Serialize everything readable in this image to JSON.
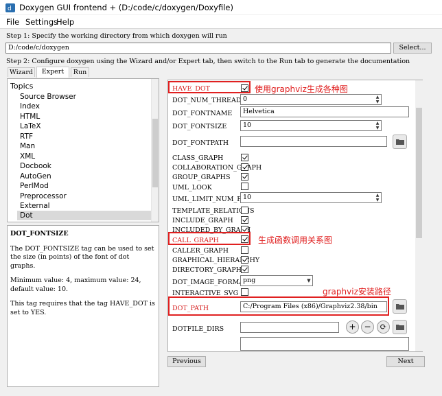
{
  "window": {
    "title": "Doxygen GUI frontend + (D:/code/c/doxygen/Doxyfile)"
  },
  "menu": {
    "file": "File",
    "settings": "Settings",
    "help": "Help"
  },
  "step1": {
    "label": "Step 1: Specify the working directory from which doxygen will run",
    "dir_value": "D:/code/c/doxygen",
    "select_button": "Select..."
  },
  "step2": {
    "label": "Step 2: Configure doxygen using the Wizard and/or Expert tab, then switch to the Run tab to generate the documentation"
  },
  "tabs": [
    "Wizard",
    "Expert",
    "Run"
  ],
  "topics": {
    "heading": "Topics",
    "items": [
      "Source Browser",
      "Index",
      "HTML",
      "LaTeX",
      "RTF",
      "Man",
      "XML",
      "Docbook",
      "AutoGen",
      "PerlMod",
      "Preprocessor",
      "External",
      "Dot"
    ],
    "selected": "Dot"
  },
  "help": {
    "title": "DOT_FONTSIZE",
    "para1": "The DOT_FONTSIZE tag can be used to set the size (in points) of the font of dot graphs.",
    "para2": "Minimum value: 4, maximum value: 24, default value: 10.",
    "para3": "This tag requires that the tag HAVE_DOT is set to YES."
  },
  "options": {
    "have_dot": "HAVE_DOT",
    "dot_num_threads": "DOT_NUM_THREADS",
    "dot_num_threads_value": "0",
    "dot_fontname": "DOT_FONTNAME",
    "dot_fontname_value": "Helvetica",
    "dot_fontsize": "DOT_FONTSIZE",
    "dot_fontsize_value": "10",
    "dot_fontpath": "DOT_FONTPATH",
    "class_graph": "CLASS_GRAPH",
    "collaboration_graph": "COLLABORATION_GRAPH",
    "group_graphs": "GROUP_GRAPHS",
    "uml_look": "UML_LOOK",
    "uml_limit": "UML_LIMIT_NUM_FIELDS",
    "uml_limit_value": "10",
    "template_relations": "TEMPLATE_RELATIONS",
    "include_graph": "INCLUDE_GRAPH",
    "included_by_graph": "INCLUDED_BY_GRAPH",
    "call_graph": "CALL_GRAPH",
    "caller_graph": "CALLER_GRAPH",
    "graphical_hierarchy": "GRAPHICAL_HIERARCHY",
    "directory_graph": "DIRECTORY_GRAPH",
    "dot_image_format": "DOT_IMAGE_FORMAT",
    "dot_image_format_value": "png",
    "interactive_svg": "INTERACTIVE_SVG",
    "dot_path": "DOT_PATH",
    "dot_path_value": "C:/Program Files (x86)/Graphviz2.38/bin",
    "dotfile_dirs": "DOTFILE_DIRS"
  },
  "annotations": {
    "have_dot": "使用graphviz生成各种图",
    "call_graph": "生成函数调用关系图",
    "dot_path": "graphviz安装路径"
  },
  "nav": {
    "previous": "Previous",
    "next": "Next"
  },
  "colors": {
    "annotation": "#e02020",
    "selected_topic": "#d9d9d9"
  }
}
